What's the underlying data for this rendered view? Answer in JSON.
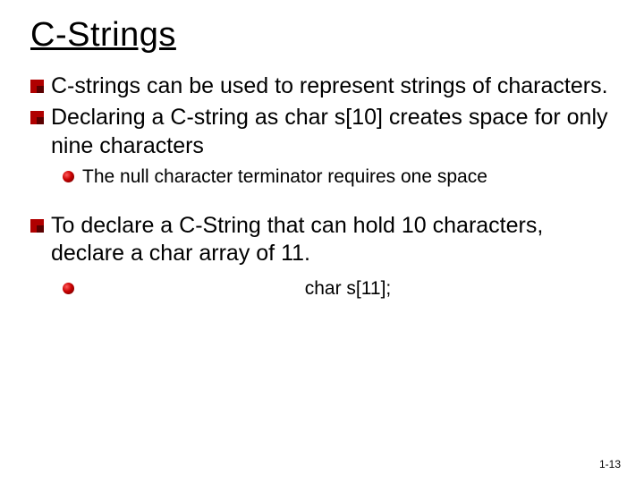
{
  "title": "C-Strings",
  "bullets": [
    {
      "level": 1,
      "text": "C-strings can be used to represent strings of characters."
    },
    {
      "level": 1,
      "text": "Declaring a C-string as char s[10] creates space for only nine characters"
    },
    {
      "level": 2,
      "text": "The null character terminator requires one space"
    },
    {
      "level": 1,
      "text": "To declare a C-String that can hold 10 characters, declare a char array of 11."
    },
    {
      "level": 2,
      "text": "char s[11];",
      "centered": true
    }
  ],
  "page_number": "1-13"
}
